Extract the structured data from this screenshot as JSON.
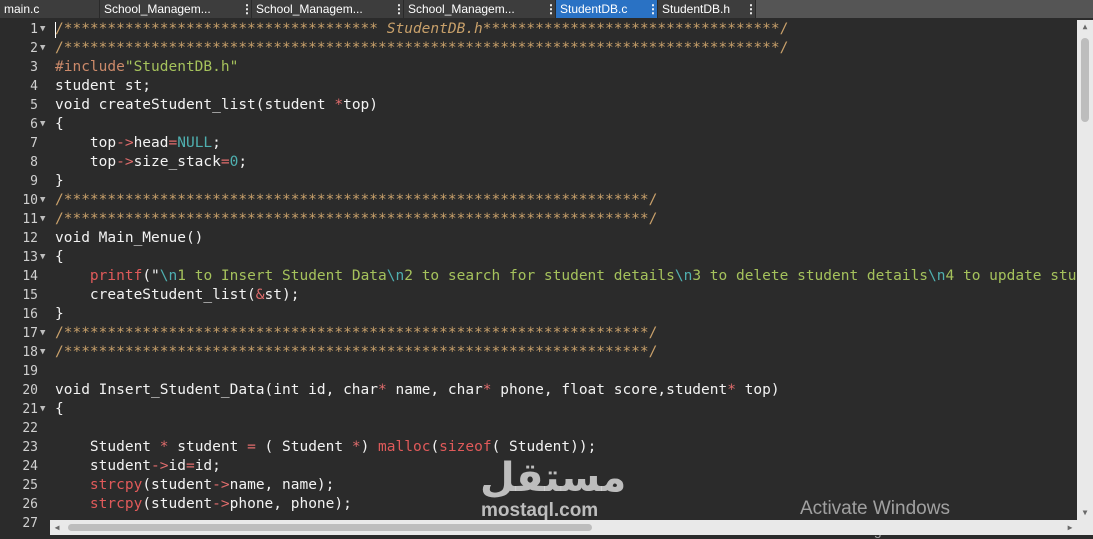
{
  "tabs": [
    {
      "label": "main.c",
      "active": false
    },
    {
      "label": "School_Managem...",
      "active": false
    },
    {
      "label": "School_Managem...",
      "active": false
    },
    {
      "label": "School_Managem...",
      "active": false
    },
    {
      "label": "StudentDB.c",
      "active": true
    },
    {
      "label": "StudentDB.h",
      "active": false
    }
  ],
  "editor": {
    "line_numbers": [
      "1",
      "2",
      "3",
      "4",
      "5",
      "6",
      "7",
      "8",
      "9",
      "10",
      "11",
      "12",
      "13",
      "14",
      "15",
      "16",
      "17",
      "18",
      "19",
      "20",
      "21",
      "22",
      "23",
      "24",
      "25",
      "26",
      "27"
    ],
    "lines": {
      "l1_a": "/************************************",
      "l1_b": " StudentDB.h",
      "l1_c": "**********************************/",
      "l2": "/**********************************************************************************/",
      "l3_a": "#include",
      "l3_b": "\"StudentDB.h\"",
      "l4": "student st;",
      "l5_a": "void createStudent_list(student ",
      "l5_b": "*",
      "l5_c": "top)",
      "l6": "{",
      "l7_a": "    top",
      "l7_b": "->",
      "l7_c": "head",
      "l7_d": "=",
      "l7_e": "NULL",
      "l7_f": ";",
      "l8_a": "    top",
      "l8_b": "->",
      "l8_c": "size_stack",
      "l8_d": "=",
      "l8_e": "0",
      "l8_f": ";",
      "l9": "}",
      "l10": "/*******************************************************************/",
      "l11": "/*******************************************************************/",
      "l12": "void Main_Menue()",
      "l13": "{",
      "l14_a": "    ",
      "l14_fn": "printf",
      "l14_b": "(\"",
      "l14_e1": "\\n",
      "l14_s1": "1 to Insert Student Data",
      "l14_e2": "\\n",
      "l14_s2": "2 to search for student details",
      "l14_e3": "\\n",
      "l14_s3": "3 to delete student details",
      "l14_e4": "\\n",
      "l14_s4": "4 to update stu",
      "l15_a": "    createStudent_list(",
      "l15_b": "&",
      "l15_c": "st);",
      "l16": "}",
      "l17": "/*******************************************************************/",
      "l18": "/*******************************************************************/",
      "l20_a": "void Insert_Student_Data(int id, char",
      "l20_b": "*",
      "l20_c": " name, char",
      "l20_d": "*",
      "l20_e": " phone, float score,student",
      "l20_f": "*",
      "l20_g": " top)",
      "l21": "{",
      "l23_a": "    Student ",
      "l23_b": "*",
      "l23_c": " student ",
      "l23_d": "=",
      "l23_e": " ( Student ",
      "l23_f": "*",
      "l23_g": ") ",
      "l23_h": "malloc",
      "l23_i": "(",
      "l23_j": "sizeof",
      "l23_k": "( Student));",
      "l24_a": "    student",
      "l24_b": "->",
      "l24_c": "id",
      "l24_d": "=",
      "l24_e": "id;",
      "l25_a": "    ",
      "l25_fn": "strcpy",
      "l25_b": "(student",
      "l25_c": "->",
      "l25_d": "name, name);",
      "l26_a": "    ",
      "l26_fn": "strcpy",
      "l26_b": "(student",
      "l26_c": "->",
      "l26_d": "phone, phone);"
    }
  },
  "watermark": {
    "arabic": "مستقل",
    "latin": "mostaql.com"
  },
  "activation": {
    "title": "Activate Windows",
    "subtitle": "Go to Settings to activate Windows."
  }
}
